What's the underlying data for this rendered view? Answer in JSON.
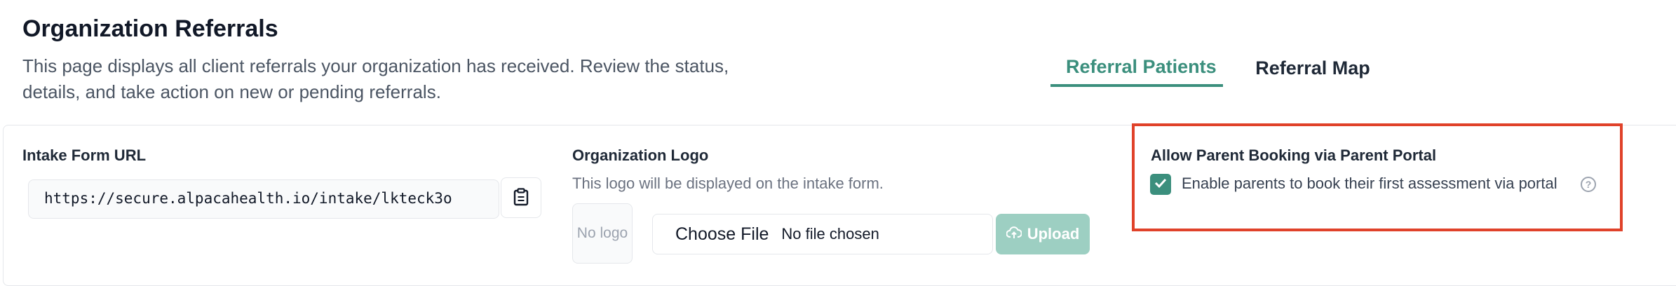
{
  "header": {
    "title": "Organization Referrals",
    "description": "This page displays all client referrals your organization has received. Review the status, details, and take action on new or pending referrals."
  },
  "tabs": [
    {
      "label": "Referral Patients",
      "active": true
    },
    {
      "label": "Referral Map",
      "active": false
    }
  ],
  "intake": {
    "label": "Intake Form URL",
    "url": "https://secure.alpacahealth.io/intake/lkteck3o",
    "copy_icon": "clipboard-icon"
  },
  "logo": {
    "label": "Organization Logo",
    "help": "This logo will be displayed on the intake form.",
    "placeholder": "No logo",
    "choose_file": "Choose File",
    "no_file": "No file chosen",
    "upload_label": "Upload",
    "upload_icon": "cloud-upload-icon"
  },
  "booking": {
    "label": "Allow Parent Booking via Parent Portal",
    "checkbox_label": "Enable parents to book their first assessment via portal",
    "checked": true,
    "help_icon": "?"
  },
  "colors": {
    "accent": "#3b8f7d",
    "upload_disabled": "#9dcfc2",
    "highlight": "#e0422a"
  }
}
